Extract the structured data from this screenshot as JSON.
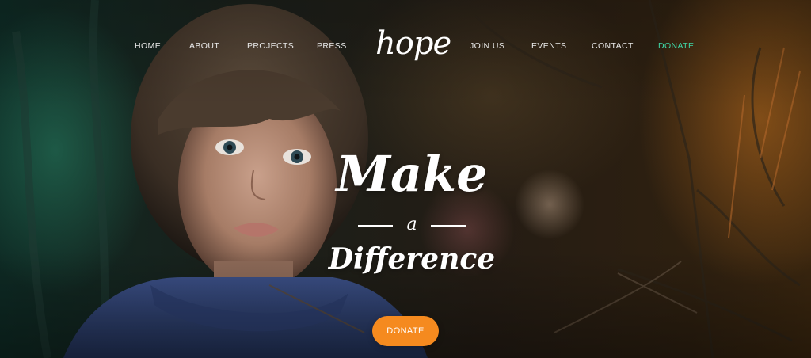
{
  "nav": {
    "left": [
      "HOME",
      "ABOUT",
      "PROJECTS",
      "PRESS"
    ],
    "right": [
      "JOIN US",
      "EVENTS",
      "CONTACT",
      "DONATE"
    ]
  },
  "logo": {
    "text": "hope"
  },
  "headline": {
    "line1": "Make",
    "line2": "a",
    "line3": "Difference"
  },
  "cta": {
    "label": "DONATE"
  },
  "colors": {
    "accent_nav": "#3fd6a6",
    "button": "#f58a1f",
    "text": "#ffffff"
  }
}
